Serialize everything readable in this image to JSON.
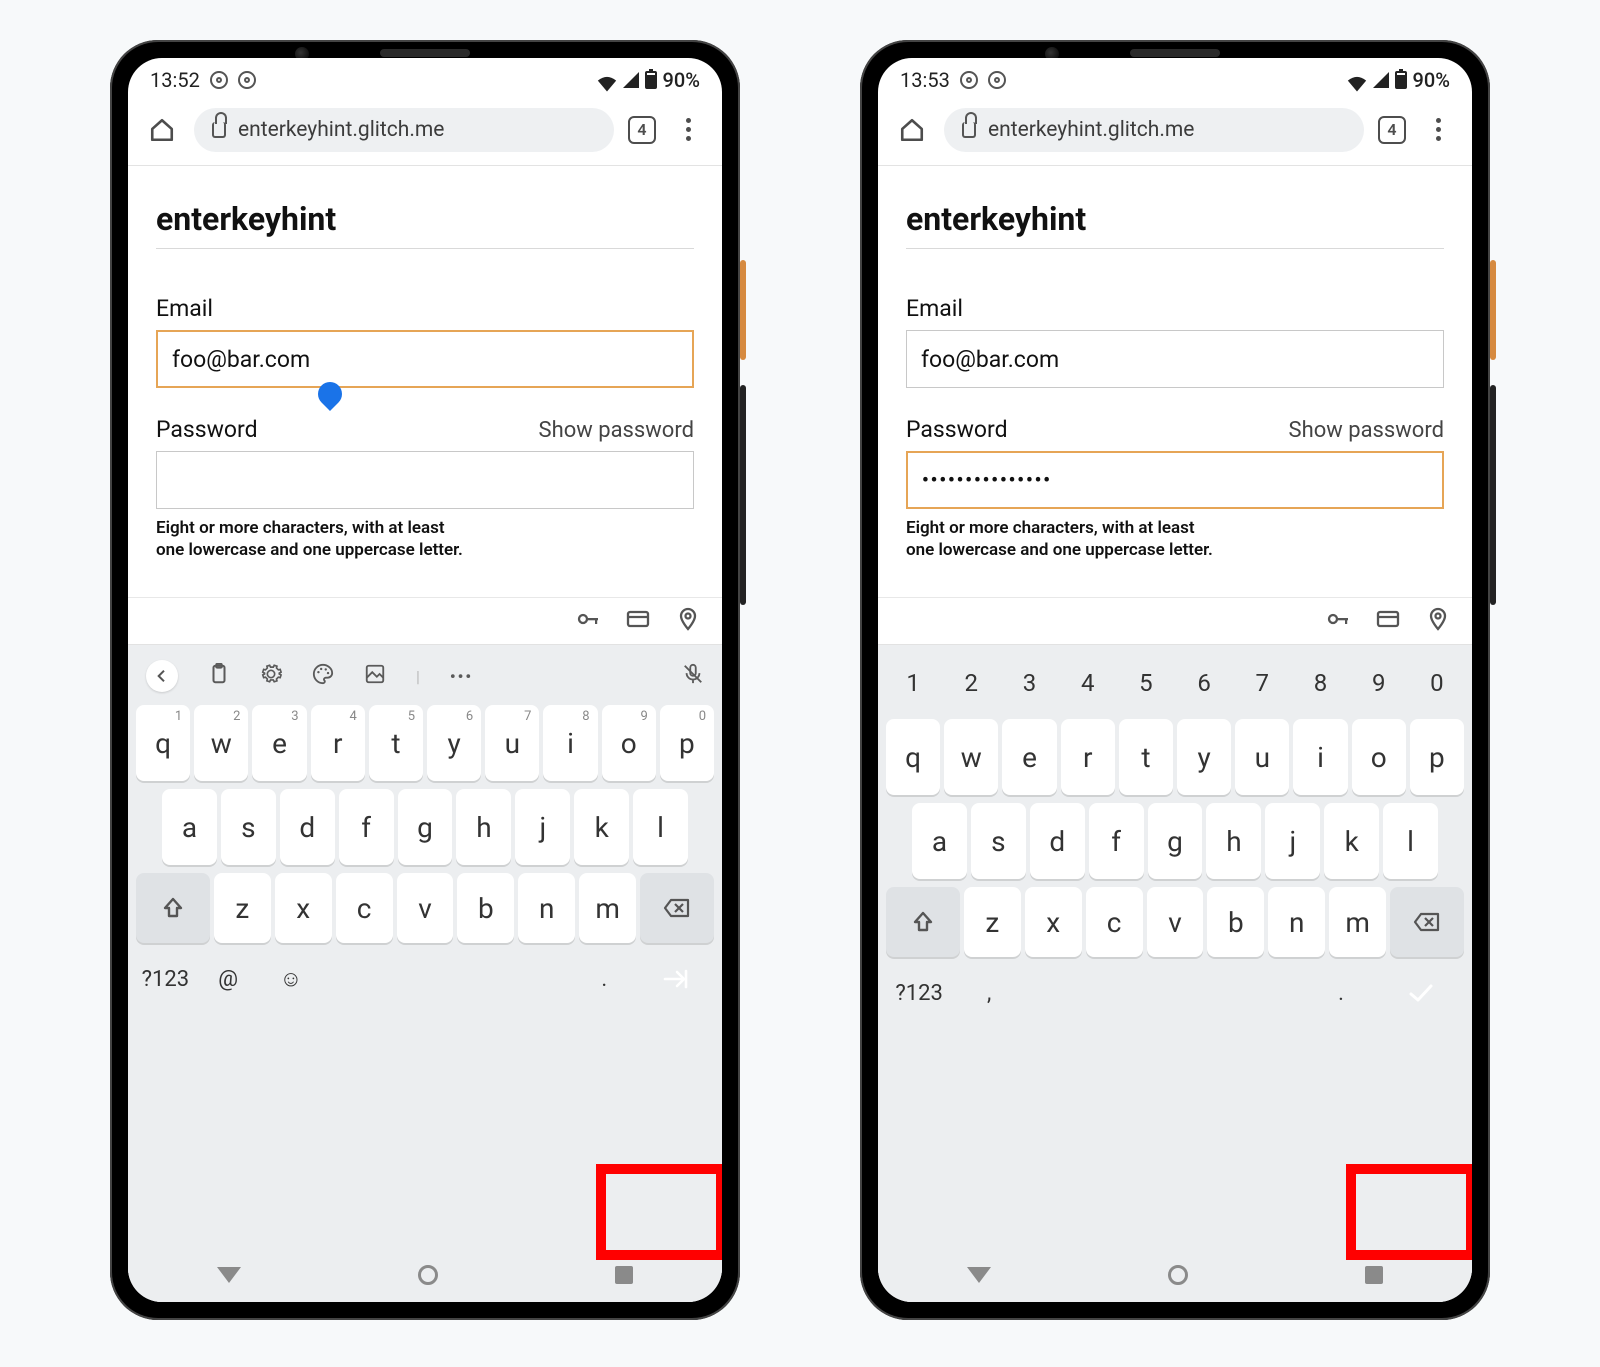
{
  "phones": [
    {
      "status_time": "13:52",
      "status_battery": "90%",
      "url": "enterkeyhint.glitch.me",
      "tab_count": "4",
      "page_title": "enterkeyhint",
      "email_label": "Email",
      "email_value": "foo@bar.com",
      "email_focused": true,
      "password_label": "Password",
      "show_password": "Show password",
      "password_value": "",
      "password_focused": false,
      "password_hint_l1": "Eight or more characters, with at least",
      "password_hint_l2": "one lowercase and one uppercase letter.",
      "keyboard_variant": "email",
      "enter_icon": "next",
      "symbol_key": "?123",
      "at_key": "@"
    },
    {
      "status_time": "13:53",
      "status_battery": "90%",
      "url": "enterkeyhint.glitch.me",
      "tab_count": "4",
      "page_title": "enterkeyhint",
      "email_label": "Email",
      "email_value": "foo@bar.com",
      "email_focused": false,
      "password_label": "Password",
      "show_password": "Show password",
      "password_value": "•••••••••••••••",
      "password_focused": true,
      "password_hint_l1": "Eight or more characters, with at least",
      "password_hint_l2": "one lowercase and one uppercase letter.",
      "keyboard_variant": "password",
      "enter_icon": "done",
      "symbol_key": "?123",
      "at_key": ","
    }
  ],
  "keys": {
    "nums": [
      "1",
      "2",
      "3",
      "4",
      "5",
      "6",
      "7",
      "8",
      "9",
      "0"
    ],
    "row1": [
      "q",
      "w",
      "e",
      "r",
      "t",
      "y",
      "u",
      "i",
      "o",
      "p"
    ],
    "row1_sup": [
      "1",
      "2",
      "3",
      "4",
      "5",
      "6",
      "7",
      "8",
      "9",
      "0"
    ],
    "row2": [
      "a",
      "s",
      "d",
      "f",
      "g",
      "h",
      "j",
      "k",
      "l"
    ],
    "row3": [
      "z",
      "x",
      "c",
      "v",
      "b",
      "n",
      "m"
    ],
    "period": "."
  }
}
